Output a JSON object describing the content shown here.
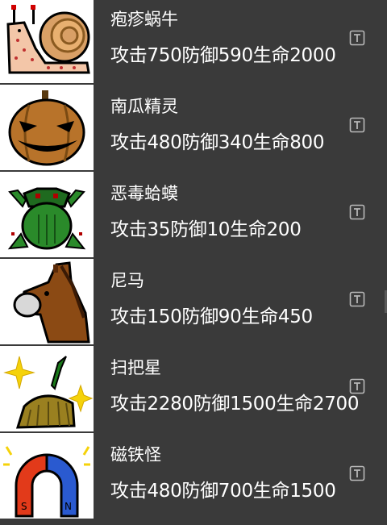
{
  "monsters": [
    {
      "name": "疱疹蜗牛",
      "stats": "攻击750防御590生命2000",
      "icon": "snail-sprite"
    },
    {
      "name": "南瓜精灵",
      "stats": "攻击480防御340生命800",
      "icon": "pumpkin-sprite"
    },
    {
      "name": "恶毒蛤蟆",
      "stats": "攻击35防御10生命200",
      "icon": "toad-sprite"
    },
    {
      "name": "尼马",
      "stats": "攻击150防御90生命450",
      "icon": "horse-sprite"
    },
    {
      "name": "扫把星",
      "stats": "攻击2280防御1500生命2700",
      "icon": "broom-star-sprite"
    },
    {
      "name": "磁铁怪",
      "stats": "攻击480防御700生命1500",
      "icon": "magnet-sprite"
    }
  ],
  "colors": {
    "background": "#3a3a3a",
    "text": "#ffffff",
    "sprite_background": "#ffffff"
  }
}
